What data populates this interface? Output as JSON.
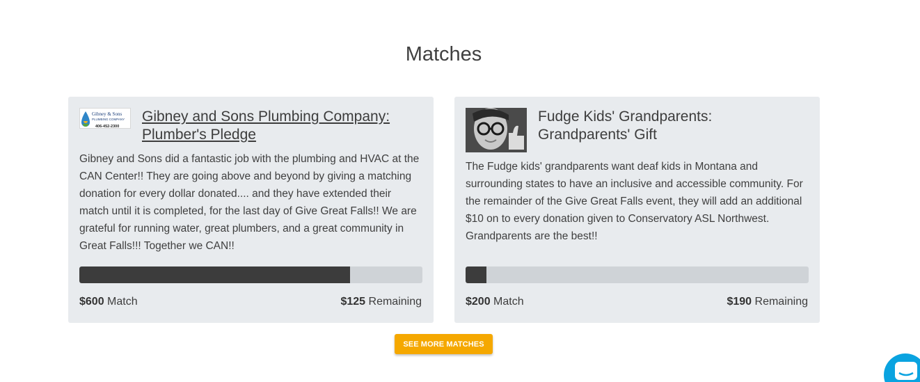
{
  "section": {
    "title": "Matches"
  },
  "matches": [
    {
      "logo_alt": "Gibney & Sons Plumbing Company logo",
      "logo_name": "Gibney & Sons",
      "logo_sub": "PLUMBING COMPANY",
      "logo_phone": "406-452-2300",
      "title_line1": "Gibney and Sons Plumbing Company:",
      "title_line2": "Plumber's Pledge",
      "description": "Gibney and Sons did a fantastic job with the plumbing and HVAC at the CAN Center!! They are going above and beyond by giving a matching donation for every dollar donated.... and they have extended their match until it is completed, for the last day of Give Great Falls!! We are grateful for running water, great plumbers, and a great community in Great Falls!!! Together we CAN!!",
      "match_amount": "$600",
      "match_label": "Match",
      "remaining_amount": "$125",
      "remaining_label": "Remaining",
      "progress_fraction": 0.79
    },
    {
      "logo_alt": "Child with glasses giving thumbs up",
      "title_line1": "Fudge Kids' Grandparents:",
      "title_line2": "Grandparents' Gift",
      "description": "The Fudge kids' grandparents want deaf kids in Montana and surrounding states to have an inclusive and accessible community. For the remainder of the Give Great Falls event, they will add an additional $10 on to every donation given to Conservatory ASL Northwest. Grandparents are the best!!",
      "match_amount": "$200",
      "match_label": "Match",
      "remaining_amount": "$190",
      "remaining_label": "Remaining",
      "progress_fraction": 0.06
    }
  ],
  "actions": {
    "see_more_label": "SEE MORE MATCHES"
  },
  "colors": {
    "accent": "#f5a800",
    "card_bg": "#e8ebee",
    "progress_fill": "#3c3c3c",
    "chat": "#0aa3e0"
  },
  "icons": {
    "chat": "chat-bubble-icon"
  }
}
